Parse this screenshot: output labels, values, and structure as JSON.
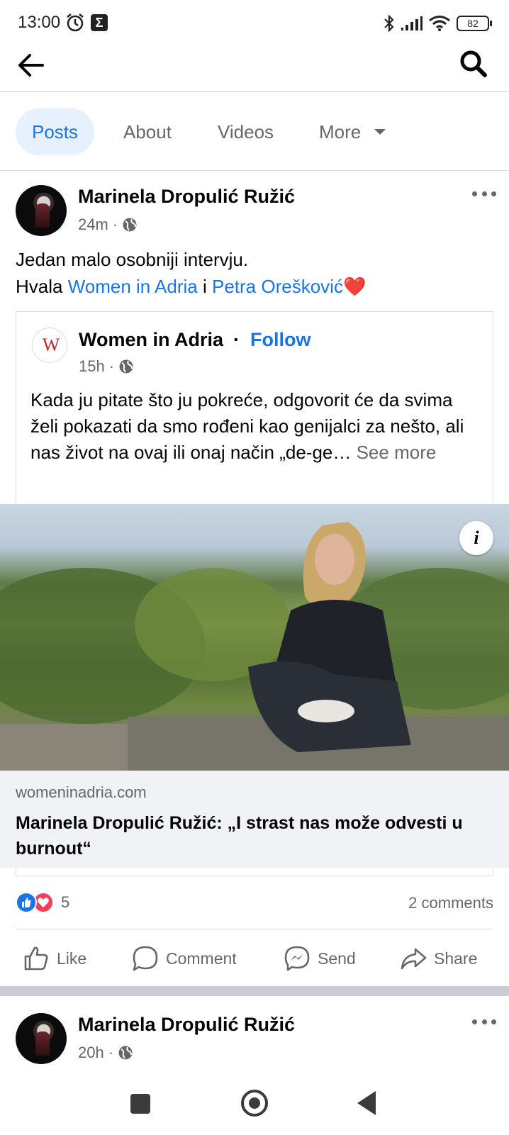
{
  "status_bar": {
    "time": "13:00",
    "battery": "82"
  },
  "tabs": {
    "posts": "Posts",
    "about": "About",
    "videos": "Videos",
    "more": "More"
  },
  "post1": {
    "author": "Marinela Dropulić Ružić",
    "time": "24m",
    "text_line1": "Jedan malo osobniji intervju.",
    "text_prefix": "Hvala ",
    "mention1": "Women in Adria",
    "text_mid": " i ",
    "mention2": "Petra Orešković",
    "emoji": "❤️",
    "shared": {
      "page_name": "Women in Adria",
      "follow_label": "Follow",
      "logo_text": "W",
      "time": "15h",
      "text": "Kada ju pitate što ju pokreće, odgovorit će da svima želi pokazati da smo rođeni kao genijalci za nešto, ali nas život na ovaj ili onaj način „de-ge…",
      "see_more": "See more",
      "link_domain": "womeninadria.com",
      "link_title": "Marinela Dropulić Ružić: „I strast nas može odvesti u burnout“"
    },
    "reaction_count": "5",
    "comments": "2 comments",
    "actions": {
      "like": "Like",
      "comment": "Comment",
      "send": "Send",
      "share": "Share"
    }
  },
  "post2": {
    "author": "Marinela Dropulić Ružić",
    "time": "20h"
  },
  "colors": {
    "accent": "#1b74e4",
    "secondary_text": "#65676b",
    "love": "#f33e58"
  }
}
